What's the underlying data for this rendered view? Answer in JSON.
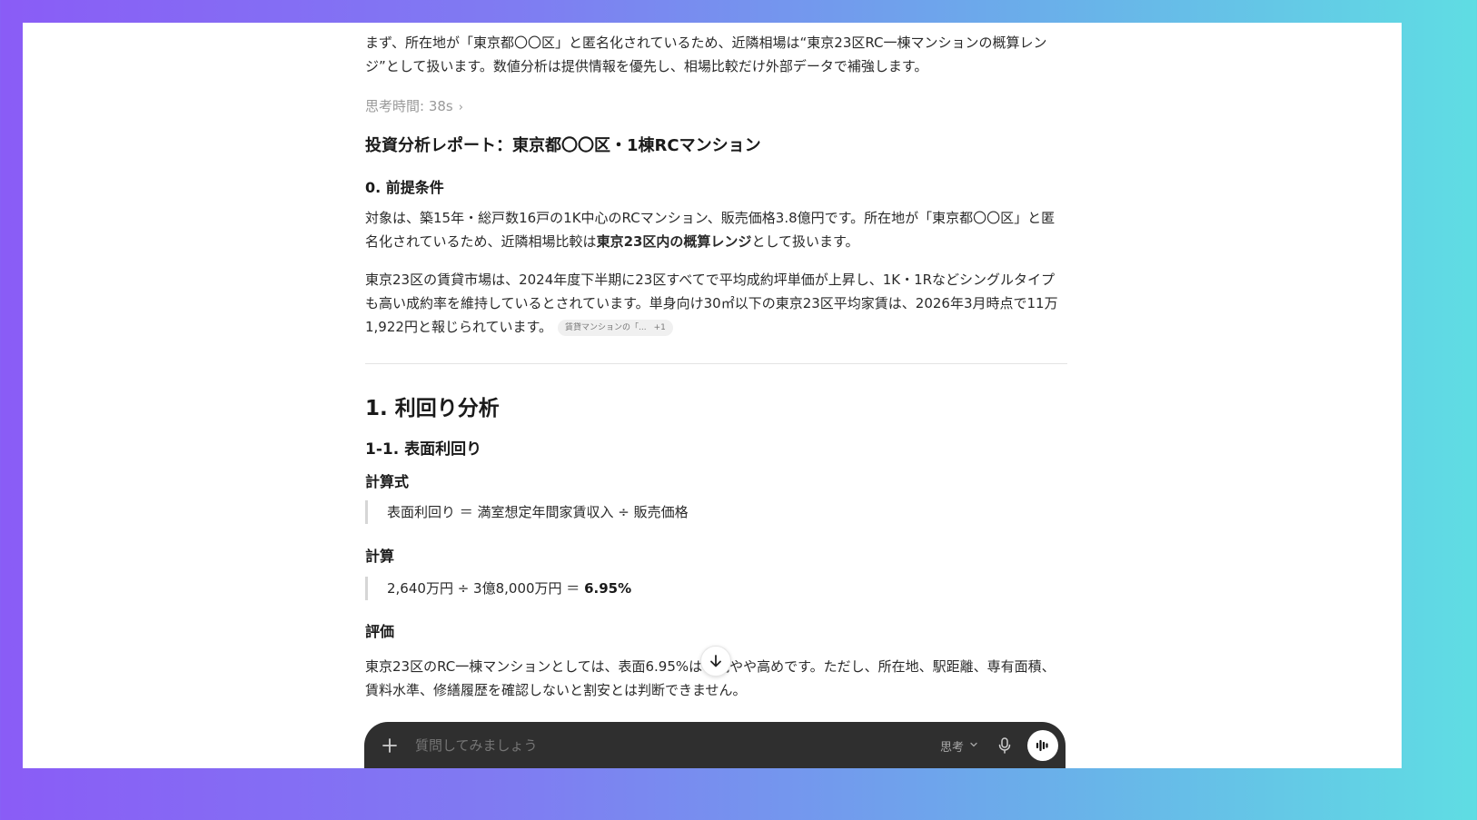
{
  "intro_text": "まず、所在地が「東京都〇〇区」と匿名化されているため、近隣相場は“東京23区RC一棟マンションの概算レンジ”として扱います。数値分析は提供情報を優先し、相場比較だけ外部データで補強します。",
  "thinking": {
    "label": "思考時間: 38s",
    "chevron": "›"
  },
  "report_title": "投資分析レポート：東京都〇〇区・1棟RCマンション",
  "section0": {
    "heading": "0. 前提条件",
    "para1_a": "対象は、築15年・総戸数16戸の1K中心のRCマンション、販売価格3.8億円です。所在地が「東京都〇〇区」と匿名化されているため、近隣相場比較は",
    "para1_bold": "東京23区内の概算レンジ",
    "para1_b": "として扱います。",
    "para2": "東京23区の賃貸市場は、2024年度下半期に23区すべてで平均成約坪単価が上昇し、1K・1Rなどシングルタイプも高い成約率を維持しているとされています。単身向け30㎡以下の東京23区平均家賃は、2026年3月時点で11万1,922円と報じられています。",
    "citation": {
      "label": "賃貸マンションの「...",
      "more": "+1"
    }
  },
  "section1": {
    "heading": "1. 利回り分析",
    "sub_heading": "1-1. 表面利回り",
    "formula_label": "計算式",
    "formula": "表面利回り ＝ 満室想定年間家賃収入 ÷ 販売価格",
    "calc_label": "計算",
    "calc_expr": "2,640万円 ÷ 3億8,000万円 ＝ ",
    "calc_result": "6.95%",
    "eval_label": "評価",
    "eval_text": "東京23区のRC一棟マンションとしては、表面6.95%は一見やや高めです。ただし、所在地、駅距離、専有面積、賃料水準、修繕履歴を確認しないと割安とは判断できません。"
  },
  "composer": {
    "placeholder": "質問してみましょう",
    "mode_label": "思考",
    "add_icon": "plus-icon",
    "mic_icon": "mic-icon",
    "voice_icon": "voice-wave-icon"
  }
}
